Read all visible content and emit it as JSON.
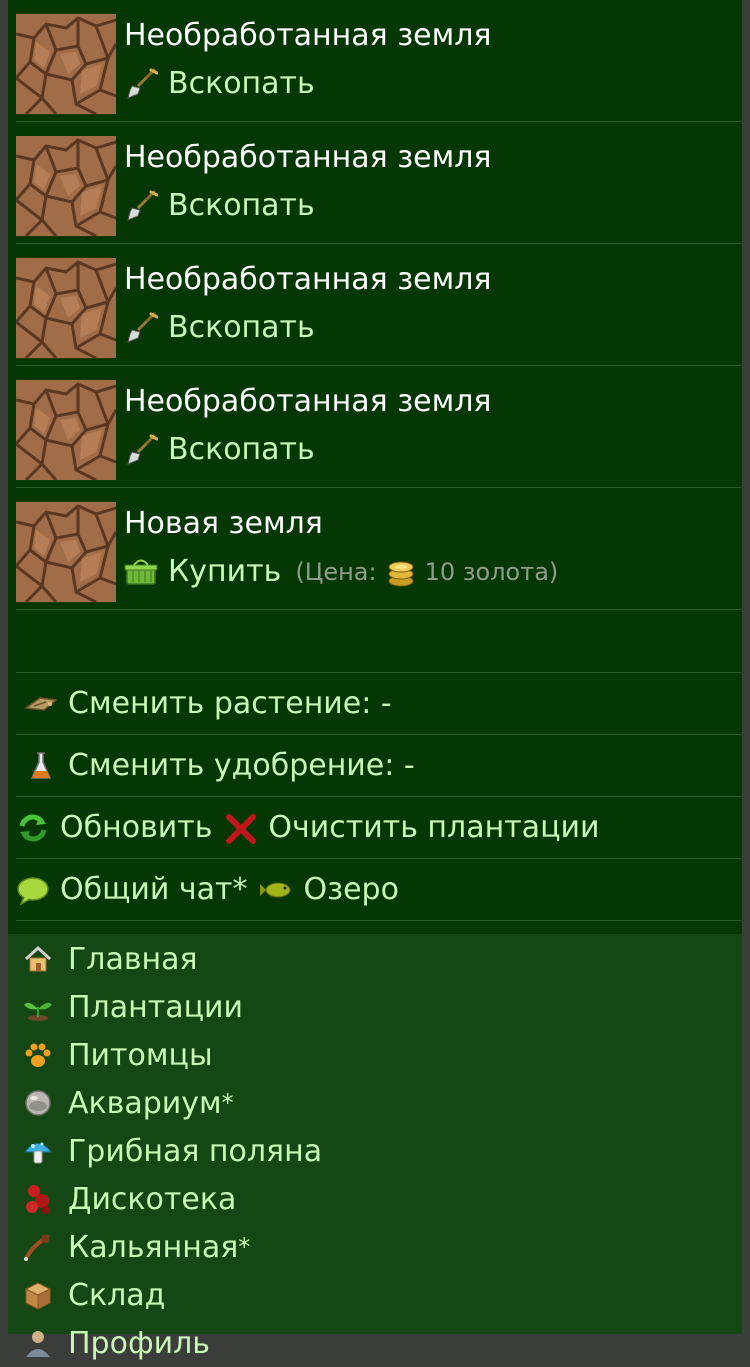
{
  "plots": [
    {
      "title": "Необработанная земля",
      "action": "Вскопать",
      "icon": "shovel-icon"
    },
    {
      "title": "Необработанная земля",
      "action": "Вскопать",
      "icon": "shovel-icon"
    },
    {
      "title": "Необработанная земля",
      "action": "Вскопать",
      "icon": "shovel-icon"
    },
    {
      "title": "Необработанная земля",
      "action": "Вскопать",
      "icon": "shovel-icon"
    },
    {
      "title": "Новая земля",
      "action": "Купить",
      "icon": "basket-icon",
      "price_prefix": "(Цена:",
      "price_value": "10 золота)"
    }
  ],
  "options": {
    "change_plant": "Сменить растение: -",
    "change_fertilizer": "Сменить удобрение: -",
    "refresh": "Обновить",
    "clear": "Очистить плантации",
    "chat": "Общий чат*",
    "lake": "Озеро"
  },
  "nav": [
    {
      "label": "Главная",
      "icon": "home-icon"
    },
    {
      "label": "Плантации",
      "icon": "sprout-icon"
    },
    {
      "label": "Питомцы",
      "icon": "paw-icon"
    },
    {
      "label": "Аквариум",
      "star": "*",
      "icon": "aquarium-icon"
    },
    {
      "label": "Грибная поляна",
      "icon": "mushroom-icon"
    },
    {
      "label": "Дискотека",
      "icon": "disco-icon"
    },
    {
      "label": "Кальянная",
      "star": "*",
      "icon": "pipe-icon"
    },
    {
      "label": "Склад",
      "icon": "box-icon"
    },
    {
      "label": "Профиль",
      "icon": "profile-icon"
    }
  ],
  "colors": {
    "background": "#053704",
    "nav_background": "#144713",
    "link": "#c9f7b6",
    "title": "#ffffff",
    "price": "#8e9f89"
  }
}
